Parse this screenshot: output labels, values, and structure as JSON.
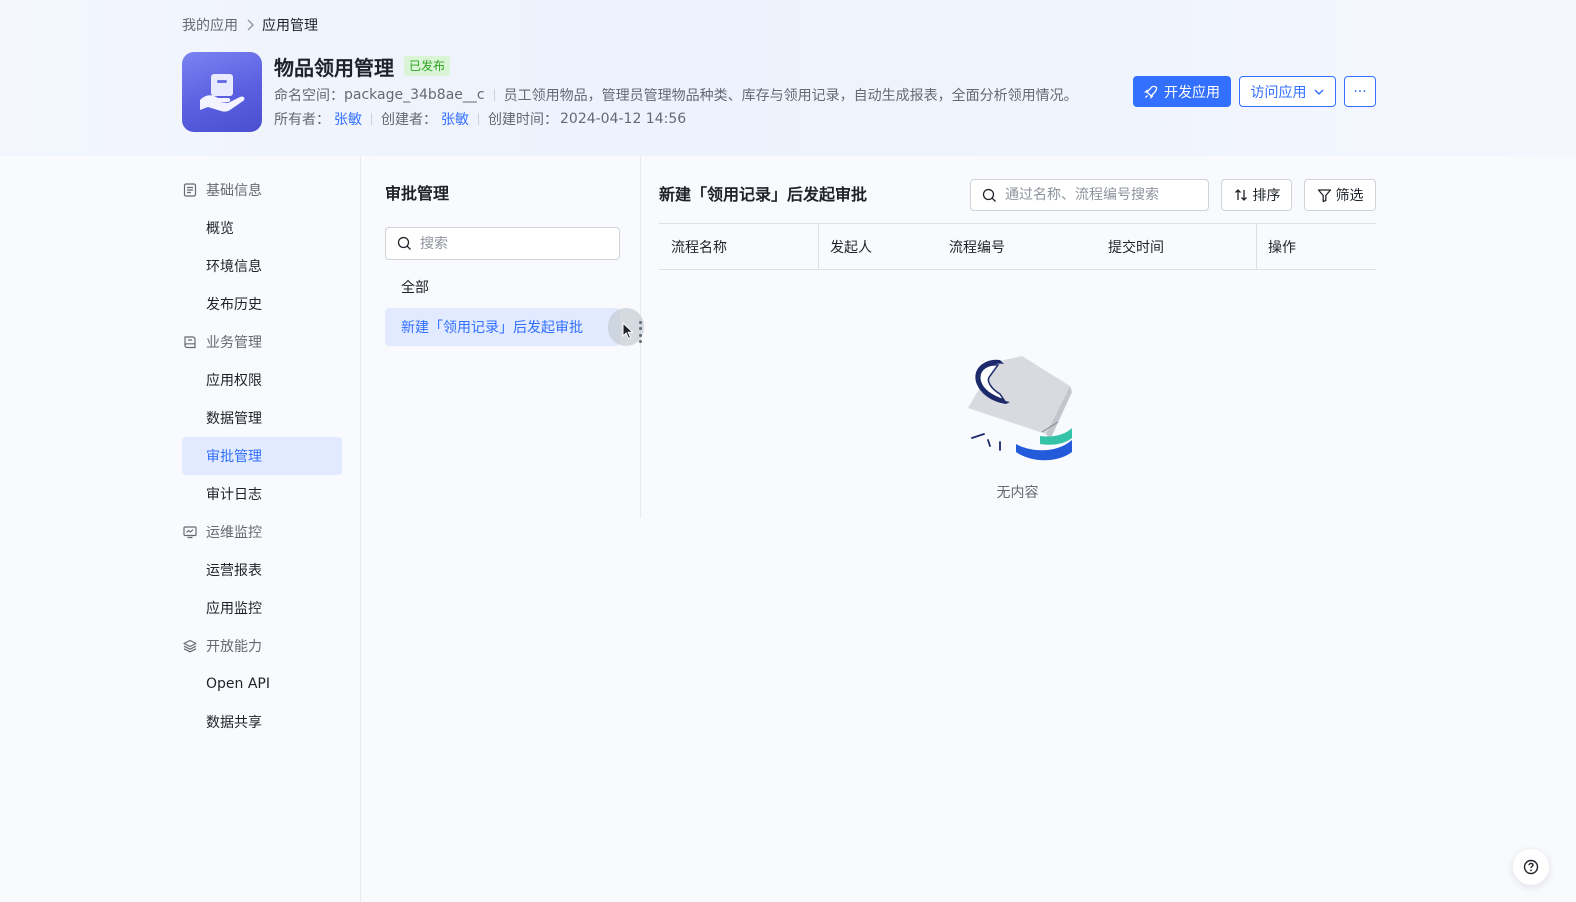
{
  "breadcrumb": {
    "parent": "我的应用",
    "current": "应用管理"
  },
  "app": {
    "title": "物品领用管理",
    "status": "已发布",
    "namespace_label": "命名空间：",
    "namespace": "package_34b8ae__c",
    "description": "员工领用物品，管理员管理物品种类、库存与领用记录，自动生成报表，全面分析领用情况。",
    "owner_label": "所有者：",
    "owner": "张敏",
    "creator_label": "创建者：",
    "creator": "张敏",
    "created_label": "创建时间：",
    "created_time": "2024-04-12 14:56"
  },
  "actions": {
    "dev": "开发应用",
    "visit": "访问应用",
    "more": "···"
  },
  "nav": {
    "groups": [
      {
        "label": "基础信息",
        "items": [
          "概览",
          "环境信息",
          "发布历史"
        ]
      },
      {
        "label": "业务管理",
        "items": [
          "应用权限",
          "数据管理",
          "审批管理",
          "审计日志"
        ]
      },
      {
        "label": "运维监控",
        "items": [
          "运营报表",
          "应用监控"
        ]
      },
      {
        "label": "开放能力",
        "items": [
          "Open API",
          "数据共享"
        ]
      }
    ],
    "active": "审批管理"
  },
  "middle": {
    "title": "审批管理",
    "search_placeholder": "搜索",
    "items": [
      "全部",
      "新建「领用记录」后发起审批"
    ]
  },
  "right": {
    "title": "新建「领用记录」后发起审批",
    "search_placeholder": "通过名称、流程编号搜索",
    "sort": "排序",
    "filter": "筛选",
    "columns": [
      "流程名称",
      "发起人",
      "流程编号",
      "提交时间",
      "操作"
    ],
    "empty": "无内容"
  },
  "colors": {
    "accent": "#3370ff",
    "accent_bg": "#e1eaff",
    "badge_green": "#2ea121"
  }
}
